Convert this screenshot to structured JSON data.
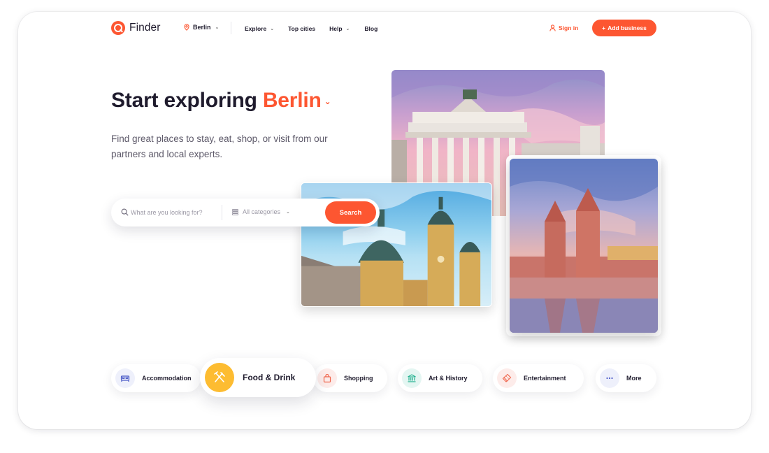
{
  "header": {
    "logo_text": "Finder",
    "city": "Berlin",
    "nav": [
      "Explore",
      "Top cities",
      "Help",
      "Blog"
    ],
    "sign_in": "Sign in",
    "add_business": "Add business"
  },
  "hero": {
    "title_prefix": "Start exploring",
    "title_city": "Berlin",
    "subtitle": "Find great places to stay, eat, shop, or visit from our partners and local experts."
  },
  "search": {
    "placeholder": "What are you looking for?",
    "category_label": "All categories",
    "button": "Search"
  },
  "categories": [
    {
      "label": "Accommodation",
      "icon": "bed-icon"
    },
    {
      "label": "Food & Drink",
      "icon": "fork-knife-icon"
    },
    {
      "label": "Shopping",
      "icon": "shopping-bag-icon"
    },
    {
      "label": "Art & History",
      "icon": "museum-icon"
    },
    {
      "label": "Entertainment",
      "icon": "ticket-icon"
    },
    {
      "label": "More",
      "icon": "dots-icon"
    }
  ],
  "colors": {
    "accent": "#fd5631",
    "food_icon_bg": "#fdbc31",
    "text_dark": "#1f1b2d",
    "text_muted": "#5e5a6a"
  }
}
